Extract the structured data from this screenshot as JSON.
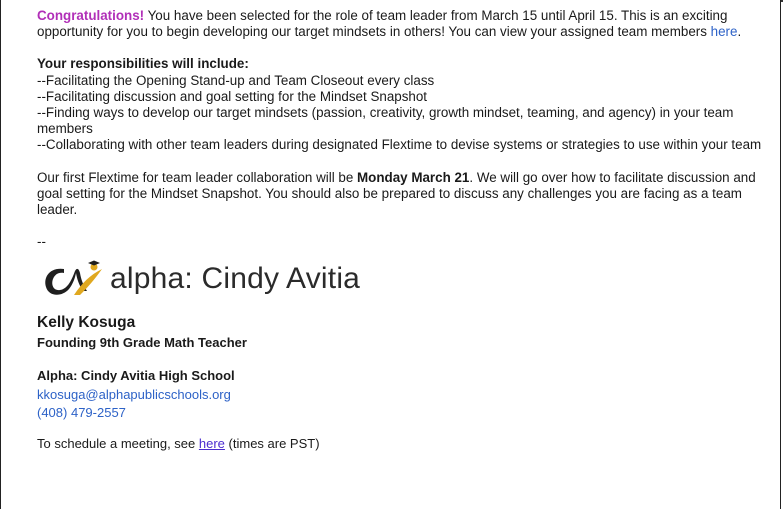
{
  "email": {
    "intro": {
      "highlight": "Congratulations!",
      "text": " You have been selected for the role of team leader from March 15 until April 15. This is an exciting opportunity for you to begin developing our target mindsets in others! You can view your assigned team members ",
      "link": "here",
      "end": "."
    },
    "responsibilities": {
      "heading": "Your responsibilities will include:",
      "items": [
        "--Facilitating the Opening Stand-up and Team Closeout every class",
        "--Facilitating discussion and goal setting for the Mindset Snapshot",
        "--Finding ways to develop our target mindsets (passion, creativity, growth mindset, teaming, and agency) in your team members",
        "--Collaborating with other team leaders during designated Flextime to devise systems or strategies to use within your team"
      ]
    },
    "flextime": {
      "before": "Our first Flextime for team leader collaboration will be ",
      "bold": "Monday March 21",
      "after": ". We will go over how to facilitate discussion and goal setting for the Mindset Snapshot. You should also be prepared to discuss any challenges you are facing as a team leader."
    },
    "separator": "--"
  },
  "signature": {
    "logo_text": "alpha: Cindy Avitia",
    "name": "Kelly Kosuga",
    "title": "Founding 9th Grade Math Teacher",
    "school": "Alpha: Cindy Avitia High School",
    "email": "kkosuga@alphapublicschools.org",
    "phone": "(408) 479-2557",
    "schedule": {
      "before": "To schedule a meeting, see ",
      "link": "here",
      "after": " (times are PST)"
    }
  },
  "colors": {
    "congrats": "#b12fb8",
    "link": "#2d62c7",
    "logo_gold": "#e0a81f",
    "logo_dark": "#1f1f1f"
  }
}
